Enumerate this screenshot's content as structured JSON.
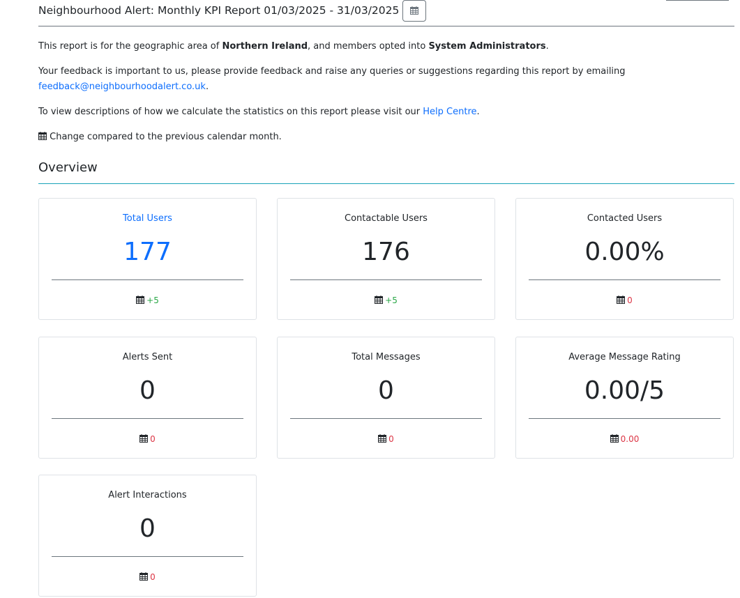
{
  "header": {
    "title": "Neighbourhood Alert: Monthly KPI Report 01/03/2025 - 31/03/2025",
    "calendar_icon": "calendar-icon"
  },
  "intro": {
    "p1_before": "This report is for the geographic area of ",
    "p1_area": "Northern Ireland",
    "p1_middle": ", and members opted into ",
    "p1_group": "System Administrators",
    "p1_end": ".",
    "p2_text": "Your feedback is important to us, please provide feedback and raise any queries or suggestions regarding this report by emailing",
    "p2_email": "feedback@neighbourhoodalert.co.uk",
    "p2_end": ".",
    "p3_text": "To view descriptions of how we calculate the statistics on this report please visit our ",
    "p3_link": "Help Centre",
    "p3_end": ".",
    "p4_text": "Change compared to the previous calendar month."
  },
  "overview": {
    "heading": "Overview",
    "cards": [
      {
        "title": "Total Users",
        "value": "177",
        "change": "+5"
      },
      {
        "title": "Contactable Users",
        "value": "176",
        "change": "+5"
      },
      {
        "title": "Contacted Users",
        "value": "0.00%",
        "change": "0"
      },
      {
        "title": "Alerts Sent",
        "value": "0",
        "change": "0"
      },
      {
        "title": "Total Messages",
        "value": "0",
        "change": "0"
      },
      {
        "title": "Average Message Rating",
        "value": "0.00/5",
        "change": "0.00"
      },
      {
        "title": "Alert Interactions",
        "value": "0",
        "change": "0"
      }
    ]
  },
  "colors": {
    "link": "#0d6efd",
    "positive": "#28a745",
    "negative": "#dc3545",
    "overview_rule": "#17a2b8"
  }
}
